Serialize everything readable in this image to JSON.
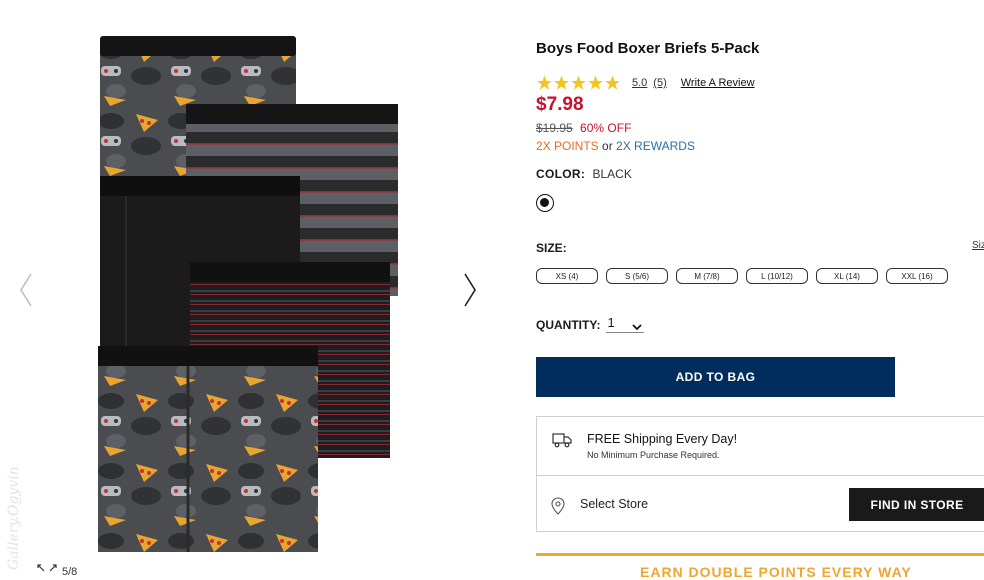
{
  "product": {
    "title": "Boys Food Boxer Briefs 5-Pack",
    "rating_value": "5.0",
    "rating_count": "(5)",
    "write_review": "Write A Review",
    "price": "$7.98",
    "was_price": "$19.95",
    "discount": "60% OFF",
    "points": "2X POINTS",
    "points_or": "or",
    "rewards": "2X REWARDS",
    "color_label": "COLOR:",
    "color_value": "BLACK",
    "size_label": "SIZE:",
    "size_chart": "Size",
    "sizes": [
      "XS (4)",
      "S (5/6)",
      "M (7/8)",
      "L (10/12)",
      "XL (14)",
      "XXL (16)"
    ],
    "quantity_label": "QUANTITY:",
    "quantity_value": "1",
    "add_to_bag": "ADD TO BAG"
  },
  "shipping": {
    "title": "FREE Shipping Every Day!",
    "subtitle": "No Minimum Purchase Required.",
    "store_label": "Select Store",
    "find_in_store": "FIND IN STORE"
  },
  "gallery": {
    "zoom_count": "5/8",
    "watermark": "Gallery.Ogyvin"
  },
  "promo": {
    "banner": "EARN DOUBLE POINTS EVERY WAY"
  },
  "colors": {
    "price_red": "#c8102e",
    "points_orange": "#e46b1e",
    "rewards_blue": "#2c6ea4",
    "add_button_navy": "#002d5b",
    "star_gold": "#f5c518",
    "promo_gold": "#f0a531"
  },
  "icons": {
    "prev": "chevron-left-icon",
    "next": "chevron-right-icon",
    "zoom": "expand-icon",
    "shipping": "truck-icon",
    "store": "location-pin-icon",
    "quantity": "chevron-down-icon"
  }
}
